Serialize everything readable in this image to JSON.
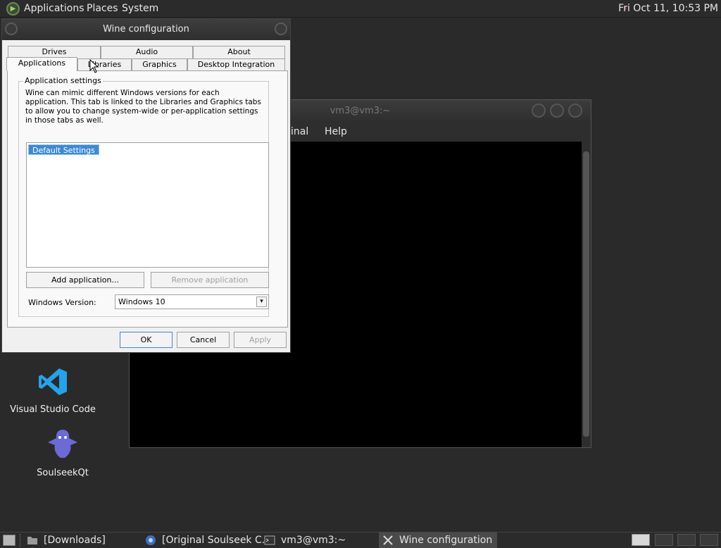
{
  "top_panel": {
    "menus": [
      "Applications",
      "Places",
      "System"
    ],
    "clock": "Fri Oct 11, 10:53 PM"
  },
  "desktop_icons": [
    {
      "label": "Visual Studio Code",
      "icon": "vscode-icon"
    },
    {
      "label": "SoulseekQt",
      "icon": "soulseek-icon"
    }
  ],
  "terminal": {
    "title": "vm3@vm3:~",
    "menu_items": [
      "inal",
      "Help"
    ]
  },
  "wine": {
    "title": "Wine configuration",
    "tabs_row1": [
      "Drives",
      "Audio",
      "About"
    ],
    "tabs_row2": [
      "Applications",
      "Libraries",
      "Graphics",
      "Desktop Integration"
    ],
    "active_tab": "Applications",
    "group_label": "Application settings",
    "description": "Wine can mimic different Windows versions for each application. This tab is linked to the Libraries and Graphics tabs to allow you to change system-wide or per-application settings in those tabs as well.",
    "app_list": [
      "Default Settings"
    ],
    "add_button": "Add application...",
    "remove_button": "Remove application",
    "version_label": "Windows Version:",
    "version_value": "Windows 10",
    "ok": "OK",
    "cancel": "Cancel",
    "apply": "Apply"
  },
  "taskbar": {
    "tasks": [
      {
        "label": "[Downloads]",
        "icon": "folder-icon"
      },
      {
        "label": "[Original Soulseek C...",
        "icon": "browser-icon"
      },
      {
        "label": "vm3@vm3:~",
        "icon": "terminal-icon"
      },
      {
        "label": "Wine configuration",
        "icon": "tools-icon"
      }
    ]
  }
}
